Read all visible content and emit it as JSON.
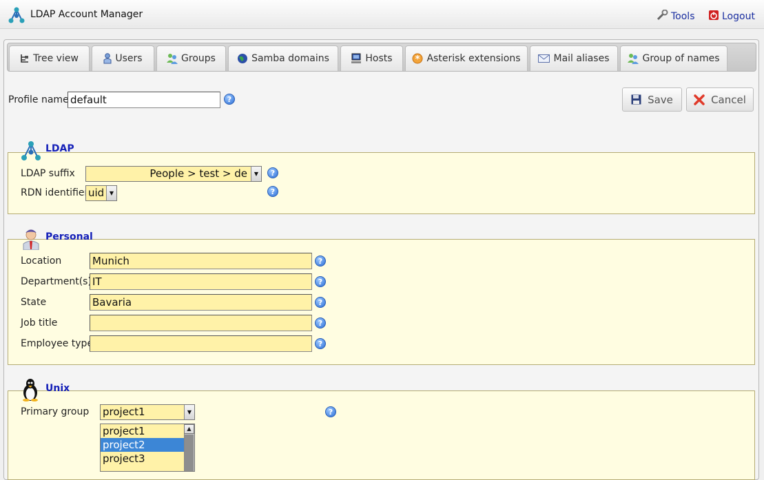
{
  "header": {
    "title": "LDAP Account Manager",
    "tools_label": "Tools",
    "logout_label": "Logout"
  },
  "tabs": [
    {
      "label": "Tree view",
      "icon": "tree-view-icon"
    },
    {
      "label": "Users",
      "icon": "user-icon"
    },
    {
      "label": "Groups",
      "icon": "groups-icon"
    },
    {
      "label": "Samba domains",
      "icon": "samba-globe-icon"
    },
    {
      "label": "Hosts",
      "icon": "host-computer-icon"
    },
    {
      "label": "Asterisk extensions",
      "icon": "asterisk-icon"
    },
    {
      "label": "Mail aliases",
      "icon": "mail-icon"
    },
    {
      "label": "Group of names",
      "icon": "group-of-names-icon"
    }
  ],
  "profile": {
    "label": "Profile name",
    "value": "default",
    "save_label": "Save",
    "cancel_label": "Cancel"
  },
  "ldap": {
    "legend": "LDAP",
    "suffix_label": "LDAP suffix",
    "suffix_value": "People > test > de",
    "rdn_label": "RDN identifier",
    "rdn_value": "uid"
  },
  "personal": {
    "legend": "Personal",
    "fields": [
      {
        "label": "Location",
        "value": "Munich"
      },
      {
        "label": "Department(s)",
        "value": "IT"
      },
      {
        "label": "State",
        "value": "Bavaria"
      },
      {
        "label": "Job title",
        "value": ""
      },
      {
        "label": "Employee type",
        "value": ""
      }
    ]
  },
  "unix": {
    "legend": "Unix",
    "primary_group_label": "Primary group",
    "primary_group_value": "project1",
    "groups_list": [
      "project1",
      "project2",
      "project3"
    ],
    "selected_group": "project2"
  },
  "colors": {
    "input_bg": "#fff2a8",
    "fieldset_bg": "#fffde1",
    "legend_text": "#1520b8",
    "link_text": "#1a2ea0",
    "selection": "#3c86d6"
  }
}
